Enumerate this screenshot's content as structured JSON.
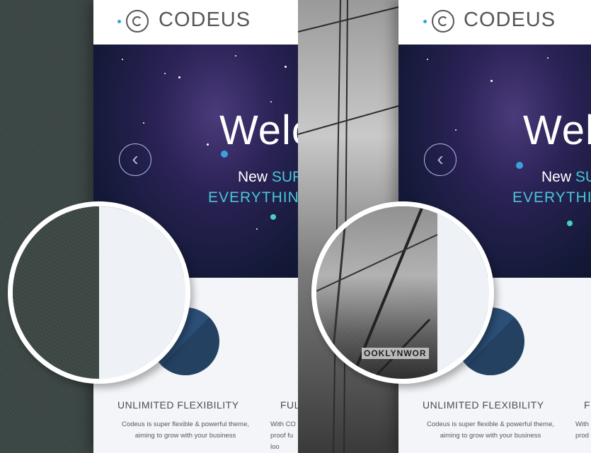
{
  "brand": {
    "name": "CODEUS"
  },
  "hero": {
    "welcome": "Welc",
    "line1_plain": "New ",
    "line1_highlight": "SUPER",
    "line1_highlight_b": "SU",
    "line2": "EVERYTHING y",
    "line2_b": "EVERYTHING",
    "prev_arrow": "‹"
  },
  "features": {
    "left_title": "UNLIMITED FLEXIBILITY",
    "left_desc": "Codeus is super flexible & powerful theme, aiming to grow with your business",
    "right_title_partial": "FUL",
    "right_desc_partial": "With CO\nproof fu\nloo",
    "far_right_title_partial": "F",
    "far_right_desc_partial": "With\nprod"
  },
  "photo_sign": "OOKLYNWOR",
  "colors": {
    "accent": "#48c7d8",
    "dot_blue": "#29a9d8",
    "icon_bg": "#2c4f78"
  }
}
